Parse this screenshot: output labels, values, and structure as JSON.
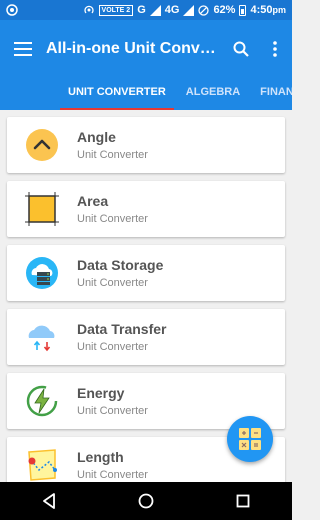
{
  "status_bar": {
    "volte_label": "VOLTE 2",
    "network_g": "G",
    "network_4g": "4G",
    "battery": "62%",
    "time": "4:50",
    "ampm": "pm"
  },
  "app_bar": {
    "title": "All-in-one Unit Converter",
    "menu_icon": "hamburger-menu-icon",
    "search_icon": "search-icon",
    "more_icon": "more-vert-icon"
  },
  "tabs": [
    {
      "label": "UNIT CONVERTER",
      "active": true
    },
    {
      "label": "ALGEBRA",
      "active": false
    },
    {
      "label": "FINANCE",
      "active": false
    }
  ],
  "colors": {
    "status_bar": "#1976d2",
    "app_bar": "#1e88e5",
    "tab_indicator": "#e53935",
    "fab": "#2196f3"
  },
  "converters": [
    {
      "title": "Angle",
      "subtitle": "Unit Converter",
      "icon": "angle-icon"
    },
    {
      "title": "Area",
      "subtitle": "Unit Converter",
      "icon": "area-icon"
    },
    {
      "title": "Data Storage",
      "subtitle": "Unit Converter",
      "icon": "data-storage-icon"
    },
    {
      "title": "Data Transfer",
      "subtitle": "Unit Converter",
      "icon": "data-transfer-icon"
    },
    {
      "title": "Energy",
      "subtitle": "Unit Converter",
      "icon": "energy-icon"
    },
    {
      "title": "Length",
      "subtitle": "Unit Converter",
      "icon": "length-icon"
    }
  ],
  "fab": {
    "icon": "calculator-grid-icon"
  },
  "nav_bar": {
    "back_icon": "back-icon",
    "home_icon": "home-icon",
    "recents_icon": "recents-icon"
  }
}
